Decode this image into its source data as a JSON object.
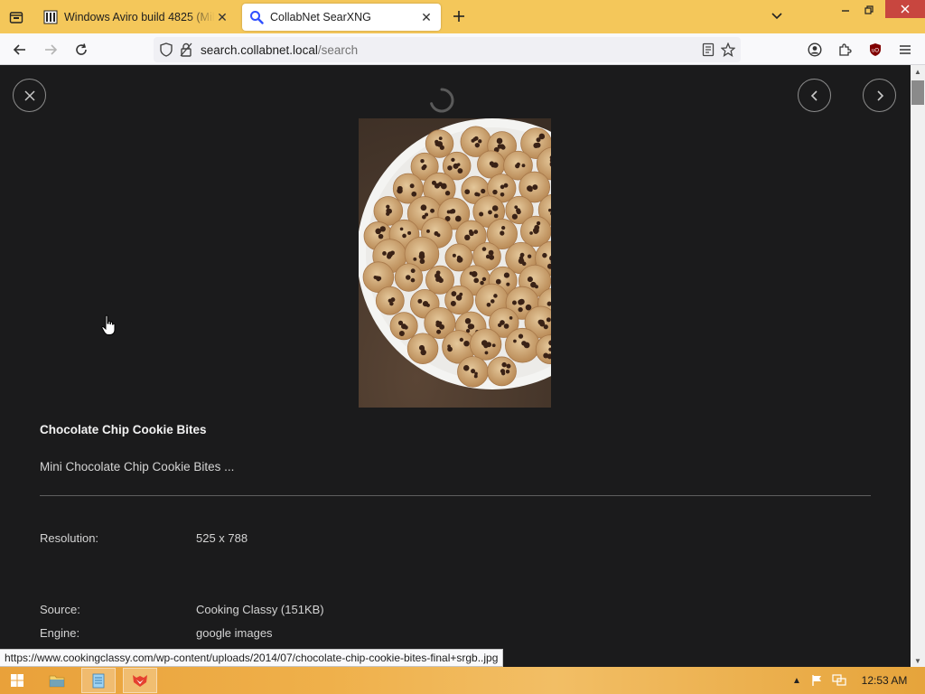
{
  "browser": {
    "tabs": [
      {
        "title": "Windows Aviro build 4825 (Mile",
        "active": false
      },
      {
        "title": "CollabNet SearXNG",
        "active": true
      }
    ],
    "url": {
      "scheme": "",
      "host": "search.collabnet.local",
      "path": "/search"
    }
  },
  "viewer": {
    "title": "Chocolate Chip Cookie Bites",
    "description": "Mini Chocolate Chip Cookie Bites ...",
    "meta": [
      {
        "label": "Resolution:",
        "value": "525 x 788"
      },
      {
        "label": "Source:",
        "value": "Cooking Classy (151KB)"
      },
      {
        "label": "Engine:",
        "value": "google images"
      }
    ]
  },
  "status_bar": {
    "link": "https://www.cookingclassy.com/wp-content/uploads/2014/07/chocolate-chip-cookie-bites-final+srgb..jpg"
  },
  "taskbar": {
    "clock": "12:53 AM"
  },
  "colors": {
    "tabbar": "#f4c75a",
    "content_bg": "#1b1b1c",
    "close_button": "#c8463f"
  }
}
